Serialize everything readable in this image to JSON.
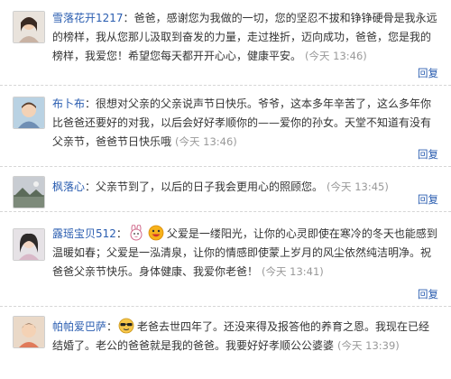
{
  "reply_label": "回复",
  "colors": {
    "username": "#2a5db0",
    "time": "#999999",
    "text": "#333333"
  },
  "comments": [
    {
      "username": "雪落花开1217",
      "text": "爸爸，感谢您为我做的一切，您的坚忍不拔和铮铮硬骨是我永远的榜样，我从您那儿汲取到奋发的力量，走过挫折，迈向成功，爸爸，您是我的榜样，我爱您！希望您每天都开开心心，健康平安。",
      "time": "(今天 13:46)",
      "avatar_icon": "user-avatar-girl"
    },
    {
      "username": "布卜布",
      "text": "很想对父亲的父亲说声节日快乐。爷爷，这本多年辛苦了，这么多年你比爸爸还要好的对我，以后会好好孝顺你的——爱你的孙女。天堂不知道有没有父亲节，爸爸节日快乐哦",
      "time": "(今天 13:46)",
      "avatar_icon": "user-avatar-boy"
    },
    {
      "username": "枫落心",
      "text": "父亲节到了，以后的日子我会更用心的照顾您。",
      "time": "(今天 13:45)",
      "avatar_icon": "user-avatar-scenery"
    },
    {
      "username": "露瑶宝贝512",
      "text": "父爱是一缕阳光，让你的心灵即使在寒冷的冬天也能感到温暖如春；父爱是一泓清泉，让你的情感即使蒙上岁月的风尘依然纯洁明净。祝爸爸父亲节快乐。身体健康、我爱你老爸！",
      "time": "(今天 13:41)",
      "avatar_icon": "user-avatar-girl-2",
      "emoticons": [
        "bunny-emoticon",
        "smile-emoticon"
      ]
    },
    {
      "username": "帕帕爱巴萨",
      "text": "老爸去世四年了。还没来得及报答他的养育之恩。我现在已经结婚了。老公的爸爸就是我的爸爸。我要好好孝顺公公婆婆",
      "time": "(今天 13:39)",
      "avatar_icon": "user-avatar-child",
      "emoticons": [
        "sunglasses-emoticon"
      ]
    }
  ]
}
